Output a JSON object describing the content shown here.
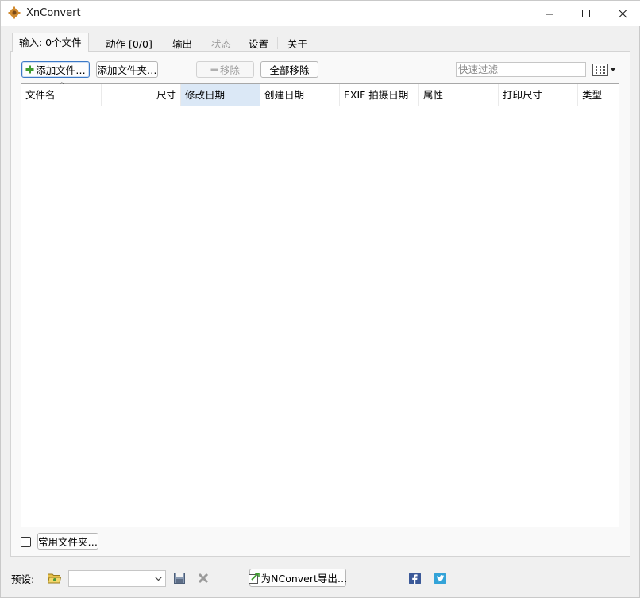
{
  "window": {
    "title": "XnConvert",
    "icon": "xnconvert-logo-icon",
    "controls": [
      "minimize-icon",
      "maximize-icon",
      "close-icon"
    ]
  },
  "tabs": [
    {
      "label": "输入: 0个文件",
      "state": "active"
    },
    {
      "label": "动作 [0/0]",
      "state": "normal"
    },
    {
      "label": "输出",
      "state": "normal"
    },
    {
      "label": "状态",
      "state": "disabled"
    },
    {
      "label": "设置",
      "state": "normal"
    },
    {
      "label": "关于",
      "state": "normal"
    }
  ],
  "toolbar": {
    "add_files": "添加文件…",
    "add_folder": "添加文件夹…",
    "remove": "移除",
    "remove_all": "全部移除",
    "filter_placeholder": "快速过滤",
    "view_icon": "grid-view-icon"
  },
  "columns": [
    "文件名",
    "尺寸",
    "修改日期",
    "创建日期",
    "EXIF 拍摄日期",
    "属性",
    "打印尺寸",
    "类型"
  ],
  "sort": {
    "column": "文件名",
    "direction": "ascending"
  },
  "files": [],
  "bottom": {
    "favorites_checked": false,
    "favorites_button": "常用文件夹…",
    "preset_label": "预设:",
    "preset_value": "",
    "export_button": "为NConvert导出…",
    "icons": [
      "open-folder-icon",
      "save-icon",
      "delete-icon",
      "facebook-icon",
      "twitter-icon"
    ]
  },
  "colors": {
    "accent": "#3c79c6",
    "selected_header": "#dbe8f6",
    "disabled_text": "#9a9a9a"
  }
}
